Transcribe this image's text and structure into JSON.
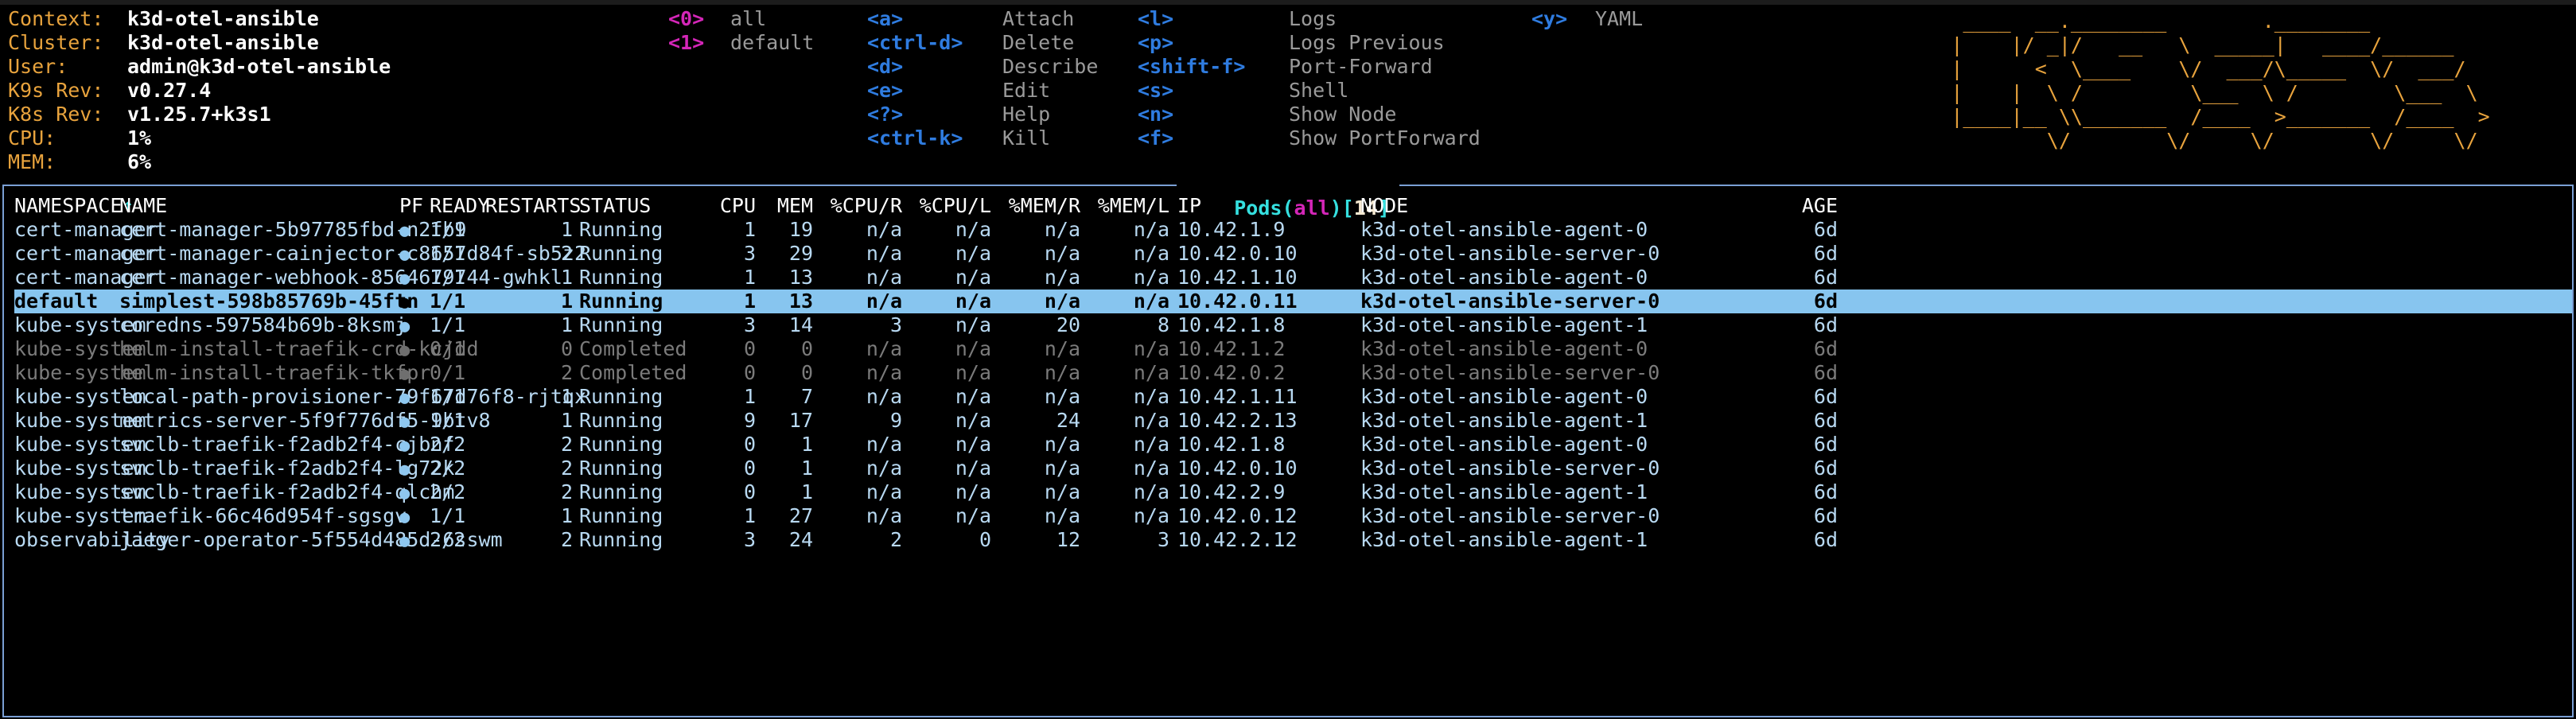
{
  "window": {
    "app": "k9s"
  },
  "header": {
    "info": [
      {
        "key": "Context:",
        "value": "k3d-otel-ansible"
      },
      {
        "key": "Cluster:",
        "value": "k3d-otel-ansible"
      },
      {
        "key": "User:",
        "value": "admin@k3d-otel-ansible"
      },
      {
        "key": "K9s Rev:",
        "value": "v0.27.4"
      },
      {
        "key": "K8s Rev:",
        "value": "v1.25.7+k3s1"
      },
      {
        "key": "CPU:",
        "value": "1%"
      },
      {
        "key": "MEM:",
        "value": "6%"
      }
    ],
    "namespaces": [
      {
        "key": "<0>",
        "label": "all"
      },
      {
        "key": "<1>",
        "label": "default"
      }
    ],
    "shortcuts_col1": [
      {
        "key": "<a>",
        "label": "Attach"
      },
      {
        "key": "<ctrl-d>",
        "label": "Delete"
      },
      {
        "key": "<d>",
        "label": "Describe"
      },
      {
        "key": "<e>",
        "label": "Edit"
      },
      {
        "key": "<?>",
        "label": "Help"
      },
      {
        "key": "<ctrl-k>",
        "label": "Kill"
      }
    ],
    "shortcuts_col2": [
      {
        "key": "<l>",
        "label": "Logs"
      },
      {
        "key": "<p>",
        "label": "Logs Previous"
      },
      {
        "key": "<shift-f>",
        "label": "Port-Forward"
      },
      {
        "key": "<s>",
        "label": "Shell"
      },
      {
        "key": "<n>",
        "label": "Show Node"
      },
      {
        "key": "<f>",
        "label": "Show PortForward"
      }
    ],
    "shortcuts_col3": [
      {
        "key": "<y>",
        "label": "YAML"
      }
    ],
    "logo_lines": [
      " ____  __.________        .________               ",
      "|    |/ _|/   __   \\  _____|   ____/______         ",
      "|      <  \\____    \\/  ___/\\_____  \\/  ___/        ",
      "|    |  \\ /         \\___  \\ /        \\___  \\       ",
      "|____|__ \\\\_______  /____  >_______  /____  >      ",
      "        \\/        \\/     \\/        \\/     \\/       "
    ],
    "logo_alt": "k9s-ascii-logo"
  },
  "panel": {
    "title_resource": "Pods",
    "title_open_paren": "(",
    "title_scope": "all",
    "title_close_paren": ")",
    "title_open_bracket": "[",
    "title_count": "14",
    "title_close_bracket": "]"
  },
  "table": {
    "columns": [
      "NAMESPACE",
      "NAME",
      "PF",
      "READY",
      "RESTARTS",
      "STATUS",
      "CPU",
      "MEM",
      "%CPU/R",
      "%CPU/L",
      "%MEM/R",
      "%MEM/L",
      "IP",
      "NODE",
      "AGE"
    ],
    "sort_column": "NAMESPACE",
    "sort_indicator": "↑",
    "rows": [
      {
        "state": "norm",
        "pf": "on",
        "namespace": "cert-manager",
        "name": "cert-manager-5b97785fbd-n2fb9",
        "ready": "1/1",
        "restarts": "1",
        "status": "Running",
        "cpu": "1",
        "mem": "19",
        "cpur": "n/a",
        "cpul": "n/a",
        "memr": "n/a",
        "meml": "n/a",
        "ip": "10.42.1.9",
        "node": "k3d-otel-ansible-agent-0",
        "age": "6d"
      },
      {
        "state": "norm",
        "pf": "on",
        "namespace": "cert-manager",
        "name": "cert-manager-cainjector-c8657d84f-sb5z2",
        "ready": "1/1",
        "restarts": "2",
        "status": "Running",
        "cpu": "3",
        "mem": "29",
        "cpur": "n/a",
        "cpul": "n/a",
        "memr": "n/a",
        "meml": "n/a",
        "ip": "10.42.0.10",
        "node": "k3d-otel-ansible-server-0",
        "age": "6d"
      },
      {
        "state": "norm",
        "pf": "on",
        "namespace": "cert-manager",
        "name": "cert-manager-webhook-8564679744-gwhkl",
        "ready": "1/1",
        "restarts": "1",
        "status": "Running",
        "cpu": "1",
        "mem": "13",
        "cpur": "n/a",
        "cpul": "n/a",
        "memr": "n/a",
        "meml": "n/a",
        "ip": "10.42.1.10",
        "node": "k3d-otel-ansible-agent-0",
        "age": "6d"
      },
      {
        "state": "sel",
        "pf": "on",
        "namespace": "default",
        "name": "simplest-598b85769b-45ftn",
        "ready": "1/1",
        "restarts": "1",
        "status": "Running",
        "cpu": "1",
        "mem": "13",
        "cpur": "n/a",
        "cpul": "n/a",
        "memr": "n/a",
        "meml": "n/a",
        "ip": "10.42.0.11",
        "node": "k3d-otel-ansible-server-0",
        "age": "6d"
      },
      {
        "state": "norm",
        "pf": "on",
        "namespace": "kube-system",
        "name": "coredns-597584b69b-8ksmj",
        "ready": "1/1",
        "restarts": "1",
        "status": "Running",
        "cpu": "3",
        "mem": "14",
        "cpur": "3",
        "cpul": "n/a",
        "memr": "20",
        "meml": "8",
        "ip": "10.42.1.8",
        "node": "k3d-otel-ansible-agent-1",
        "age": "6d"
      },
      {
        "state": "dim",
        "pf": "off",
        "namespace": "kube-system",
        "name": "helm-install-traefik-crd-kcjdd",
        "ready": "0/1",
        "restarts": "0",
        "status": "Completed",
        "cpu": "0",
        "mem": "0",
        "cpur": "n/a",
        "cpul": "n/a",
        "memr": "n/a",
        "meml": "n/a",
        "ip": "10.42.1.2",
        "node": "k3d-otel-ansible-agent-0",
        "age": "6d"
      },
      {
        "state": "dim",
        "pf": "off",
        "namespace": "kube-system",
        "name": "helm-install-traefik-tkfpr",
        "ready": "0/1",
        "restarts": "2",
        "status": "Completed",
        "cpu": "0",
        "mem": "0",
        "cpur": "n/a",
        "cpul": "n/a",
        "memr": "n/a",
        "meml": "n/a",
        "ip": "10.42.0.2",
        "node": "k3d-otel-ansible-server-0",
        "age": "6d"
      },
      {
        "state": "norm",
        "pf": "on",
        "namespace": "kube-system",
        "name": "local-path-provisioner-79f67d76f8-rjtqx",
        "ready": "1/1",
        "restarts": "1",
        "status": "Running",
        "cpu": "1",
        "mem": "7",
        "cpur": "n/a",
        "cpul": "n/a",
        "memr": "n/a",
        "meml": "n/a",
        "ip": "10.42.1.11",
        "node": "k3d-otel-ansible-agent-0",
        "age": "6d"
      },
      {
        "state": "norm",
        "pf": "on",
        "namespace": "kube-system",
        "name": "metrics-server-5f9f776df5-9btv8",
        "ready": "1/1",
        "restarts": "1",
        "status": "Running",
        "cpu": "9",
        "mem": "17",
        "cpur": "9",
        "cpul": "n/a",
        "memr": "24",
        "meml": "n/a",
        "ip": "10.42.2.13",
        "node": "k3d-otel-ansible-agent-1",
        "age": "6d"
      },
      {
        "state": "norm",
        "pf": "on",
        "namespace": "kube-system",
        "name": "svclb-traefik-f2adb2f4-cjbnf",
        "ready": "2/2",
        "restarts": "2",
        "status": "Running",
        "cpu": "0",
        "mem": "1",
        "cpur": "n/a",
        "cpul": "n/a",
        "memr": "n/a",
        "meml": "n/a",
        "ip": "10.42.1.8",
        "node": "k3d-otel-ansible-agent-0",
        "age": "6d"
      },
      {
        "state": "norm",
        "pf": "on",
        "namespace": "kube-system",
        "name": "svclb-traefik-f2adb2f4-lg72k",
        "ready": "2/2",
        "restarts": "2",
        "status": "Running",
        "cpu": "0",
        "mem": "1",
        "cpur": "n/a",
        "cpul": "n/a",
        "memr": "n/a",
        "meml": "n/a",
        "ip": "10.42.0.10",
        "node": "k3d-otel-ansible-server-0",
        "age": "6d"
      },
      {
        "state": "norm",
        "pf": "on",
        "namespace": "kube-system",
        "name": "svclb-traefik-f2adb2f4-qlchm",
        "ready": "2/2",
        "restarts": "2",
        "status": "Running",
        "cpu": "0",
        "mem": "1",
        "cpur": "n/a",
        "cpul": "n/a",
        "memr": "n/a",
        "meml": "n/a",
        "ip": "10.42.2.9",
        "node": "k3d-otel-ansible-agent-1",
        "age": "6d"
      },
      {
        "state": "norm",
        "pf": "on",
        "namespace": "kube-system",
        "name": "traefik-66c46d954f-sgsgv",
        "ready": "1/1",
        "restarts": "1",
        "status": "Running",
        "cpu": "1",
        "mem": "27",
        "cpur": "n/a",
        "cpul": "n/a",
        "memr": "n/a",
        "meml": "n/a",
        "ip": "10.42.0.12",
        "node": "k3d-otel-ansible-server-0",
        "age": "6d"
      },
      {
        "state": "norm",
        "pf": "on",
        "namespace": "observability",
        "name": "jaeger-operator-5f554d485d-6sswm",
        "ready": "2/2",
        "restarts": "2",
        "status": "Running",
        "cpu": "3",
        "mem": "24",
        "cpur": "2",
        "cpul": "0",
        "memr": "12",
        "meml": "3",
        "ip": "10.42.2.12",
        "node": "k3d-otel-ansible-agent-1",
        "age": "6d"
      }
    ]
  },
  "colors": {
    "accent_orange": "#e8a33d",
    "key_blue": "#2f7ce0",
    "key_magenta": "#d426b8",
    "label_gray": "#9a9a9a",
    "border_blue": "#7a9fd4",
    "row_text": "#b8d9f2",
    "row_dim": "#7b7b7b",
    "selection_bg": "#87c5ef",
    "title_cyan": "#35e0e0"
  }
}
